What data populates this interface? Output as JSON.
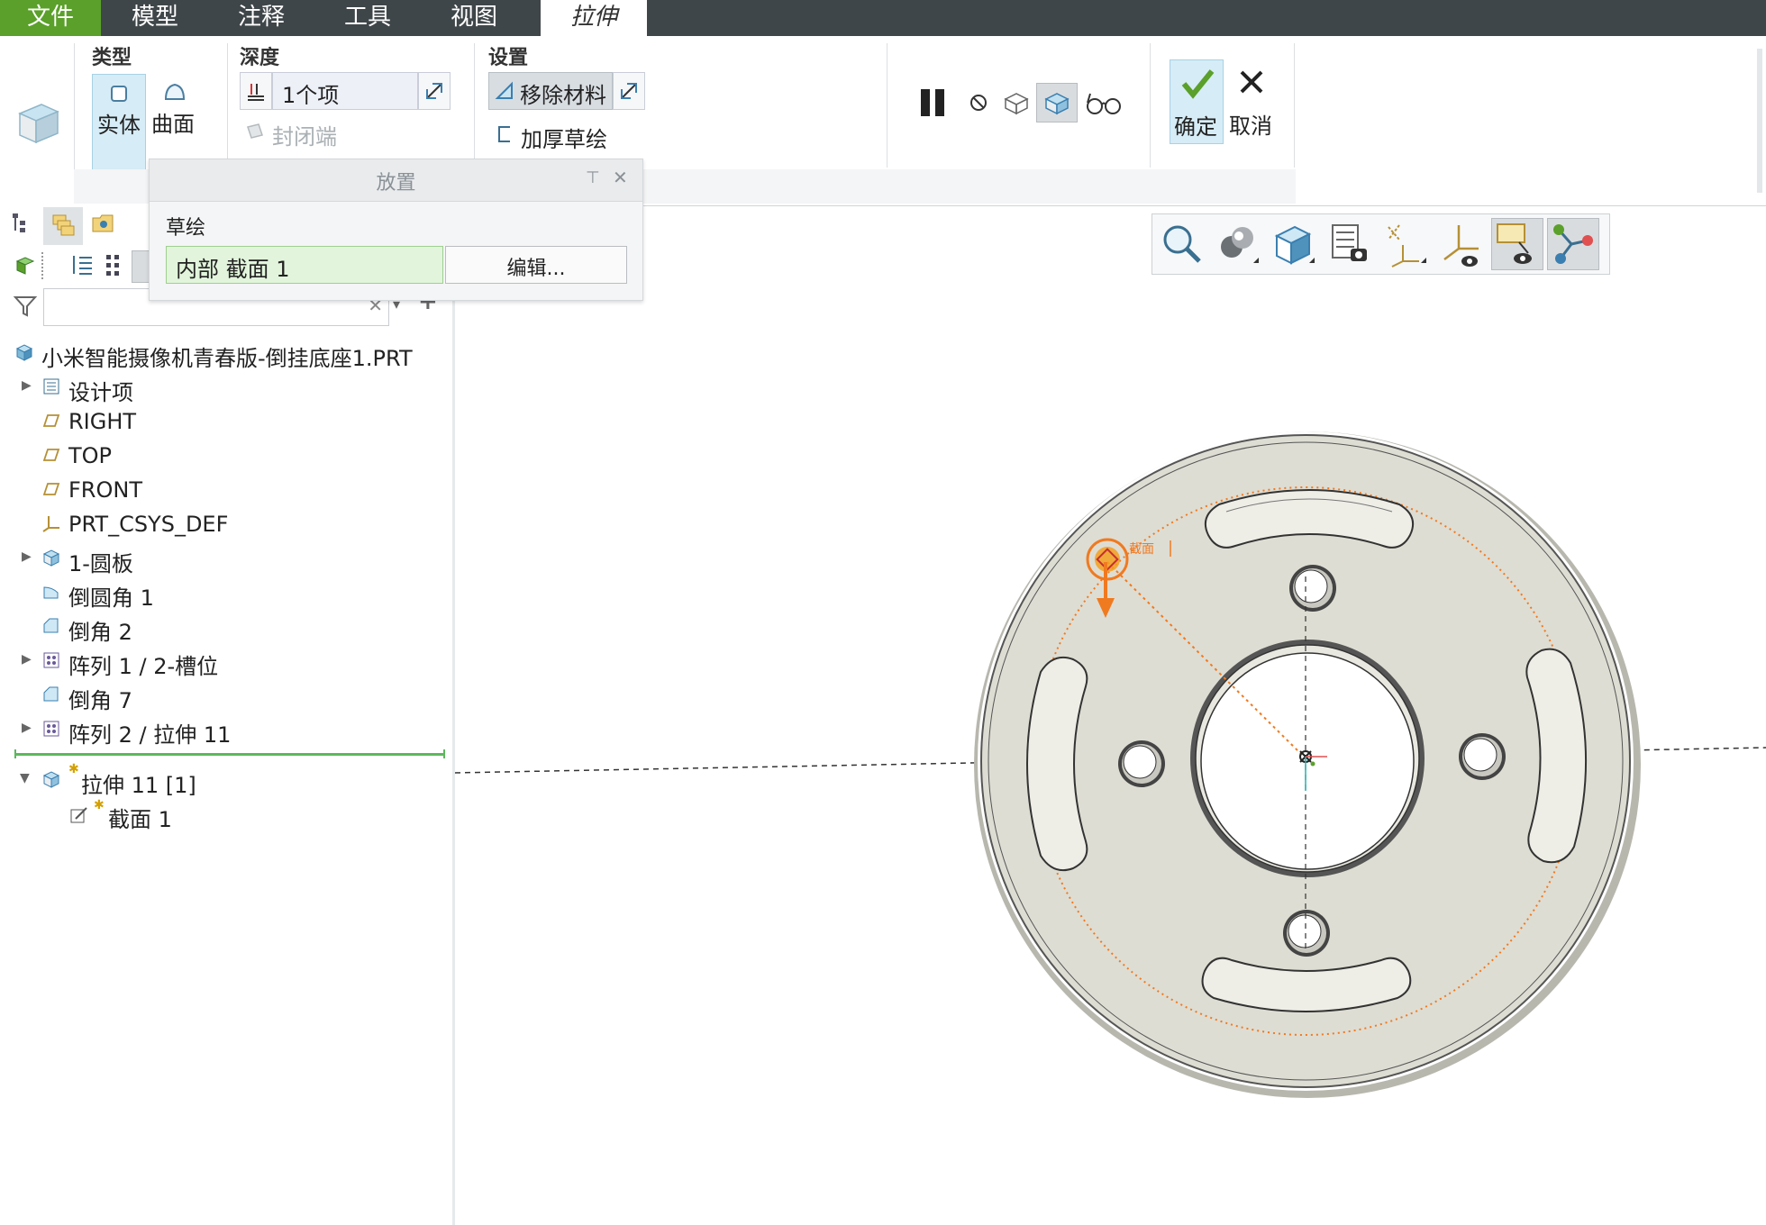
{
  "menu": {
    "tabs": [
      "文件",
      "模型",
      "注释",
      "工具",
      "视图",
      "拉伸"
    ],
    "active_tab": "拉伸"
  },
  "ribbon": {
    "type_group": {
      "title": "类型",
      "solid": "实体",
      "surface": "曲面"
    },
    "depth_group": {
      "title": "深度",
      "value": "1个项",
      "cap_ends": "封闭端"
    },
    "settings_group": {
      "title": "设置",
      "remove_material": "移除材料",
      "thicken": "加厚草绘"
    },
    "confirm": "确定",
    "cancel": "取消"
  },
  "placement_panel": {
    "title": "放置",
    "sketch_label": "草绘",
    "section_value": "内部 截面 1",
    "edit_button": "编辑..."
  },
  "model_tree": {
    "root": "小米智能摄像机青春版-倒挂底座1.PRT",
    "items": [
      {
        "label": "设计项",
        "expandable": true,
        "icon": "design-items-icon"
      },
      {
        "label": "RIGHT",
        "expandable": false,
        "icon": "datum-plane-icon"
      },
      {
        "label": "TOP",
        "expandable": false,
        "icon": "datum-plane-icon"
      },
      {
        "label": "FRONT",
        "expandable": false,
        "icon": "datum-plane-icon"
      },
      {
        "label": "PRT_CSYS_DEF",
        "expandable": false,
        "icon": "csys-icon"
      },
      {
        "label": "1-圆板",
        "expandable": true,
        "icon": "extrude-icon"
      },
      {
        "label": "倒圆角 1",
        "expandable": false,
        "icon": "round-icon"
      },
      {
        "label": "倒角 2",
        "expandable": false,
        "icon": "chamfer-icon"
      },
      {
        "label": "阵列 1 / 2-槽位",
        "expandable": true,
        "icon": "pattern-icon"
      },
      {
        "label": "倒角 7",
        "expandable": false,
        "icon": "chamfer-icon"
      },
      {
        "label": "阵列 2 / 拉伸 11",
        "expandable": true,
        "icon": "pattern-icon"
      }
    ],
    "active_feature": "拉伸 11 [1]",
    "active_child": "截面 1"
  },
  "viewport": {
    "dimension_label": "截面",
    "colors": {
      "part_face": "#deddd3",
      "dim_orange": "#f07a20",
      "accent_green": "#5aa02a",
      "select_blue": "#d6ecf6"
    }
  }
}
